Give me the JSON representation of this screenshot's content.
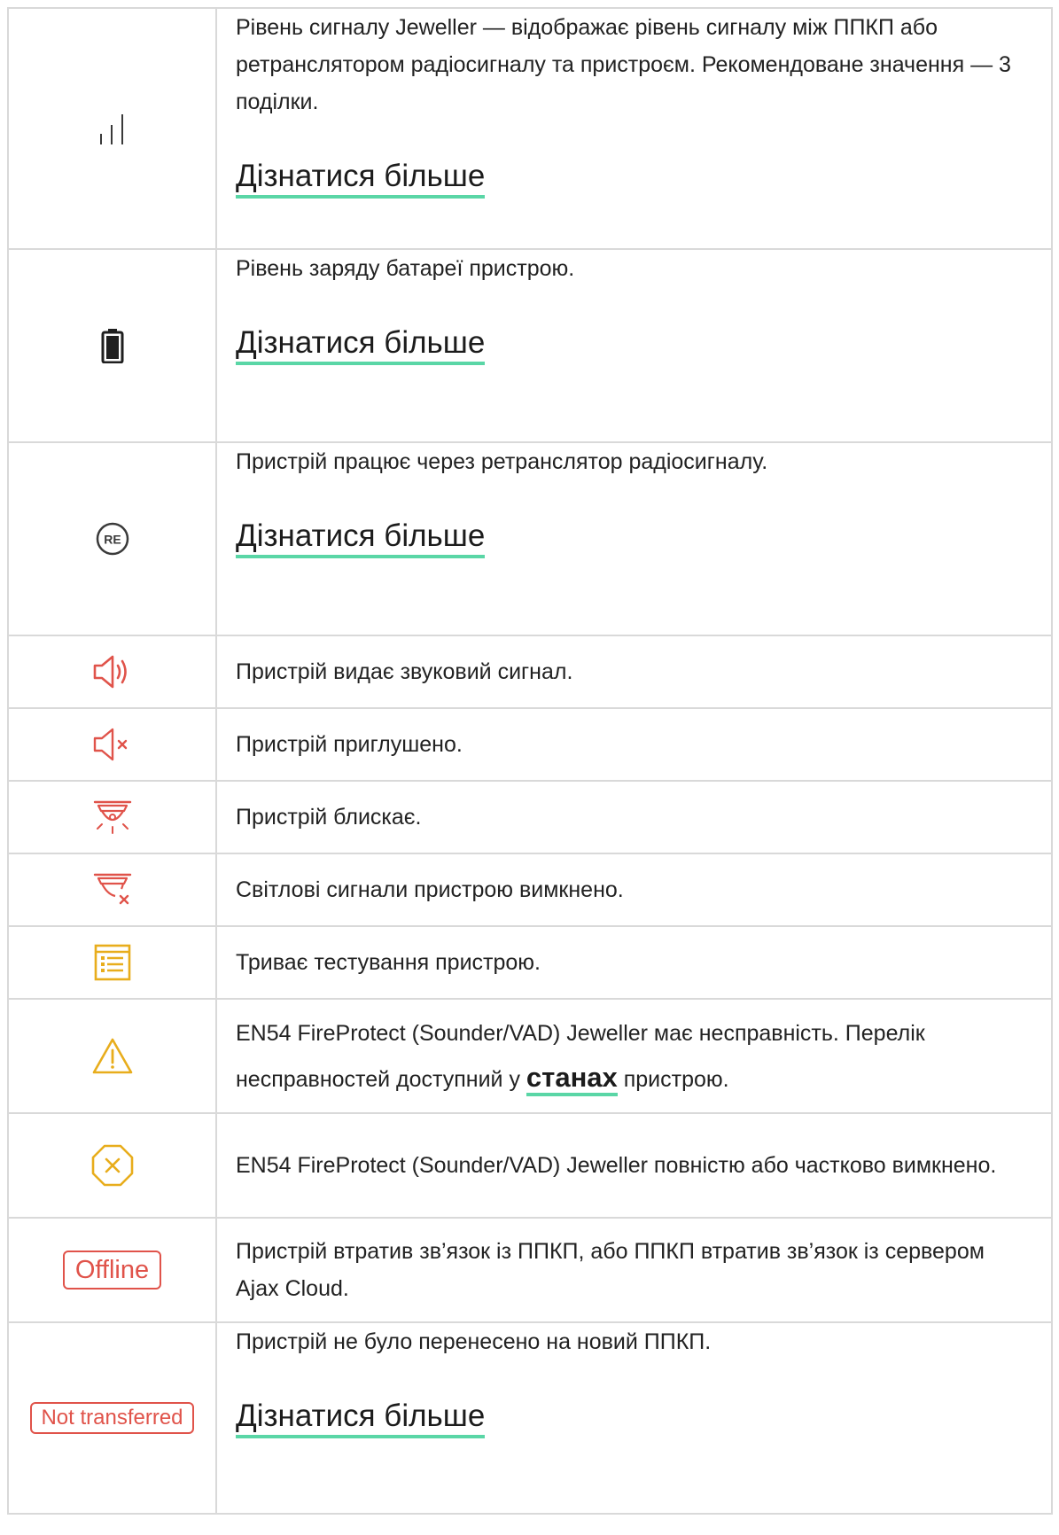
{
  "rows": [
    {
      "icon": "signal-bars-icon",
      "text": "Рівень сигналу Jeweller — відображає рівень сигналу між ППКП або ретранслятором радіосигналу та пристроєм. Рекомендоване значення — 3 поділки.",
      "link": "Дізнатися більше"
    },
    {
      "icon": "battery-icon",
      "text": "Рівень заряду батареї пристрою.",
      "link": "Дізнатися більше"
    },
    {
      "icon": "re-circle-icon",
      "icon_label": "RE",
      "text": "Пристрій працює через ретранслятор радіосигналу.",
      "link": "Дізнатися більше"
    },
    {
      "icon": "speaker-sound-icon",
      "text": "Пристрій видає звуковий сигнал."
    },
    {
      "icon": "speaker-muted-icon",
      "text": "Пристрій приглушено."
    },
    {
      "icon": "strobe-flashing-icon",
      "text": "Пристрій блискає."
    },
    {
      "icon": "strobe-off-icon",
      "text": "Світлові сигнали пристрою вимкнено."
    },
    {
      "icon": "test-checklist-icon",
      "text": "Триває тестування пристрою."
    },
    {
      "icon": "warning-triangle-icon",
      "text_before": "EN54 FireProtect (Sounder/VAD) Jeweller має несправність. Перелік несправностей доступний у ",
      "text_link": "станах",
      "text_after": " пристрою."
    },
    {
      "icon": "disabled-octagon-icon",
      "text": "EN54 FireProtect (Sounder/VAD) Jeweller повністю або частково вимкнено."
    },
    {
      "icon": "offline-badge",
      "badge": "Offline",
      "text": "Пристрій втратив зв’язок із ППКП, або ППКП втратив зв’язок із сервером Ajax Cloud."
    },
    {
      "icon": "not-transferred-badge",
      "badge": "Not transferred",
      "text": "Пристрій не було перенесено на новий ППКП.",
      "link": "Дізнатися більше"
    }
  ],
  "colors": {
    "alarm_red": "#e0534a",
    "warning_yellow": "#e8ad1c",
    "link_underline": "#5ad6a6",
    "neutral_icon": "#3a3a3a",
    "border": "#d9d9d9"
  }
}
